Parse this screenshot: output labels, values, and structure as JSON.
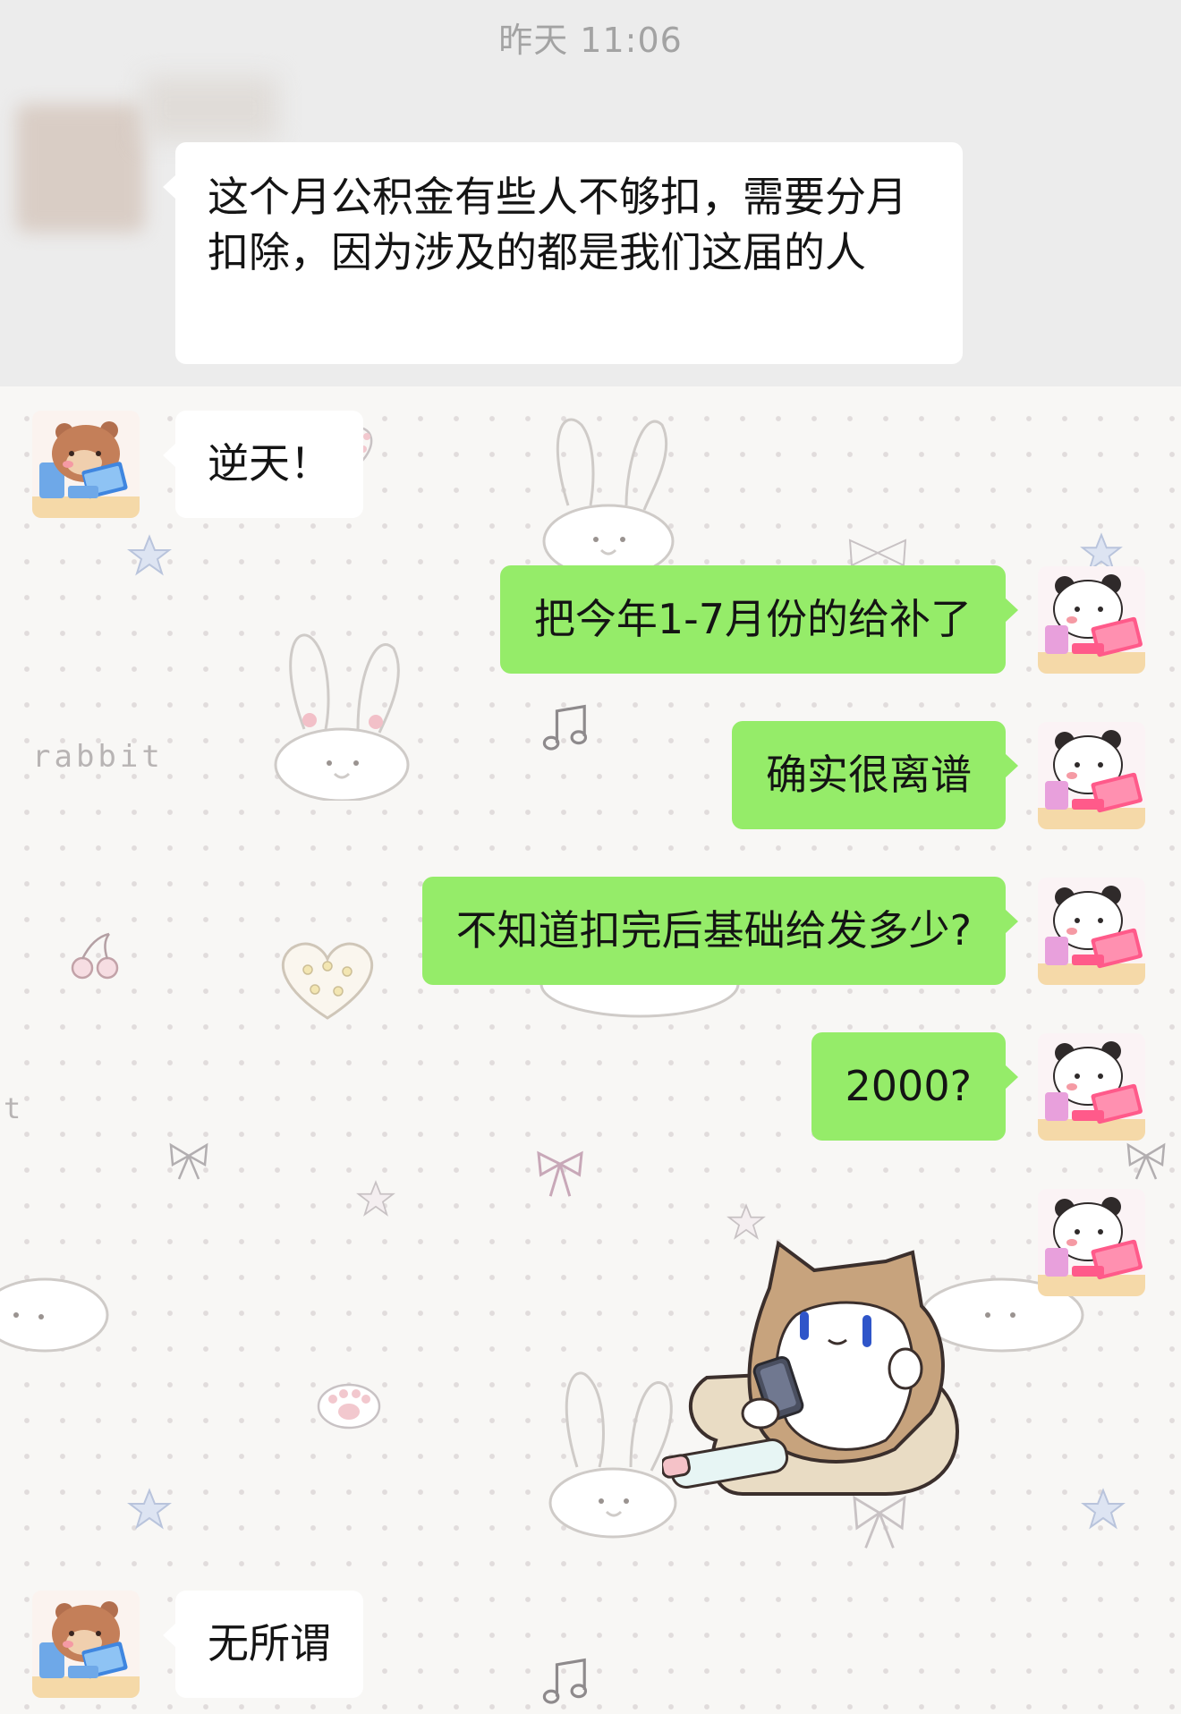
{
  "chat": {
    "timestamp": "昨天 11:06",
    "messages": [
      {
        "side": "left",
        "sender": "other-group-member",
        "text": "这个月公积金有些人不够扣，需要分月扣除，因为涉及的都是我们这届的人"
      },
      {
        "side": "left",
        "sender": "bear",
        "text": "逆天！"
      },
      {
        "side": "right",
        "sender": "me",
        "text": "把今年1-7月份的给补了"
      },
      {
        "side": "right",
        "sender": "me",
        "text": "确实很离谱"
      },
      {
        "side": "right",
        "sender": "me",
        "text": "不知道扣完后基础给发多少?"
      },
      {
        "side": "right",
        "sender": "me",
        "text": "2000?"
      },
      {
        "side": "right",
        "sender": "me",
        "type": "sticker",
        "sticker": "cat-on-phone-sticker"
      },
      {
        "side": "left",
        "sender": "bear",
        "text": "无所谓"
      }
    ]
  },
  "wallpaper": {
    "decor_text": [
      "rabbit",
      "t"
    ]
  },
  "colors": {
    "bubble_me": "#95ec69",
    "bubble_other": "#ffffff",
    "timestamp": "#a3a3a3"
  }
}
